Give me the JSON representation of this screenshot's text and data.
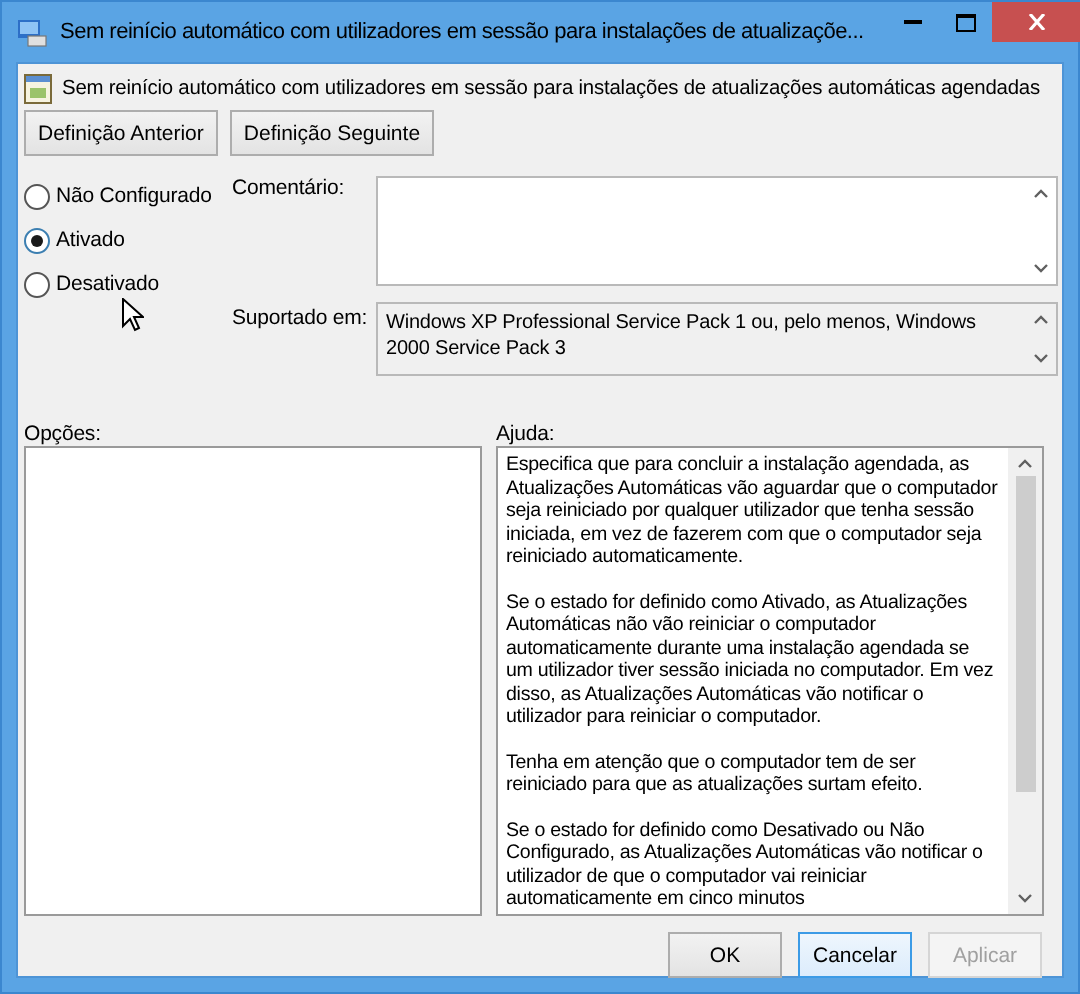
{
  "window": {
    "title": "Sem reinício automático com utilizadores em sessão para instalações de atualizaçõe..."
  },
  "setting_title": "Sem reinício automático com utilizadores em sessão para instalações de atualizações automáticas agendadas",
  "nav_buttons": [
    "Definição Anterior",
    "Definição Seguinte"
  ],
  "states": [
    {
      "label": "Não Configurado",
      "selected": false
    },
    {
      "label": "Ativado",
      "selected": true
    },
    {
      "label": "Desativado",
      "selected": false
    }
  ],
  "comment": {
    "label": "Comentário:"
  },
  "supported": {
    "label": "Suportado em:",
    "value": "Windows XP Professional Service Pack 1 ou, pelo menos, Windows 2000 Service Pack 3"
  },
  "options": {
    "label": "Opções:"
  },
  "help": {
    "label": "Ajuda:",
    "paragraphs": [
      "Especifica que para concluir a instalação agendada, as Atualizações Automáticas vão aguardar que o computador seja reiniciado por qualquer utilizador que tenha sessão iniciada, em vez de fazerem com que o computador seja reiniciado automaticamente.",
      "Se o estado for definido como Ativado, as Atualizações Automáticas não vão reiniciar o computador automaticamente durante uma instalação agendada se um utilizador tiver sessão iniciada no computador. Em vez disso, as Atualizações Automáticas vão notificar o utilizador para reiniciar o computador.",
      "Tenha em atenção que o computador tem de ser reiniciado para que as atualizações surtam efeito.",
      "Se o estado for definido como Desativado ou Não Configurado, as Atualizações Automáticas vão notificar o utilizador de que o computador vai reiniciar automaticamente em cinco minutos"
    ]
  },
  "buttons": [
    {
      "label": "OK",
      "focused": false,
      "disabled": false
    },
    {
      "label": "Cancelar",
      "focused": true,
      "disabled": false
    },
    {
      "label": "Aplicar",
      "focused": false,
      "disabled": true
    }
  ]
}
